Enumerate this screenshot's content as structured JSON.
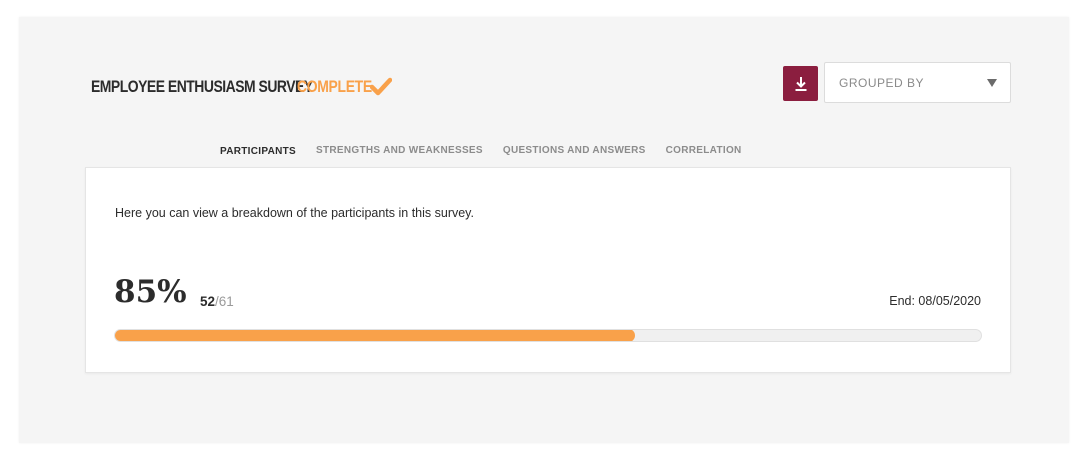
{
  "header": {
    "survey_title": "Employee Enthusiasm Survey",
    "status": "Complete",
    "status_color": "#f9a14a",
    "check_icon": "check-icon"
  },
  "toolbar": {
    "download_icon": "download-icon",
    "download_color": "#8b1e3f",
    "group_by_label": "GROUPED BY"
  },
  "tabs": [
    {
      "label": "PARTICIPANTS",
      "active": true
    },
    {
      "label": "STRENGTHS AND WEAKNESSES",
      "active": false
    },
    {
      "label": "QUESTIONS AND ANSWERS",
      "active": false
    },
    {
      "label": "CORRELATION",
      "active": false
    }
  ],
  "participants": {
    "description": "Here you can view a breakdown of the participants in this survey.",
    "percent_label": "85%",
    "completed": "52",
    "total": "/61",
    "end_date": "End: 08/05/2020",
    "progress_fraction": 0.6
  }
}
